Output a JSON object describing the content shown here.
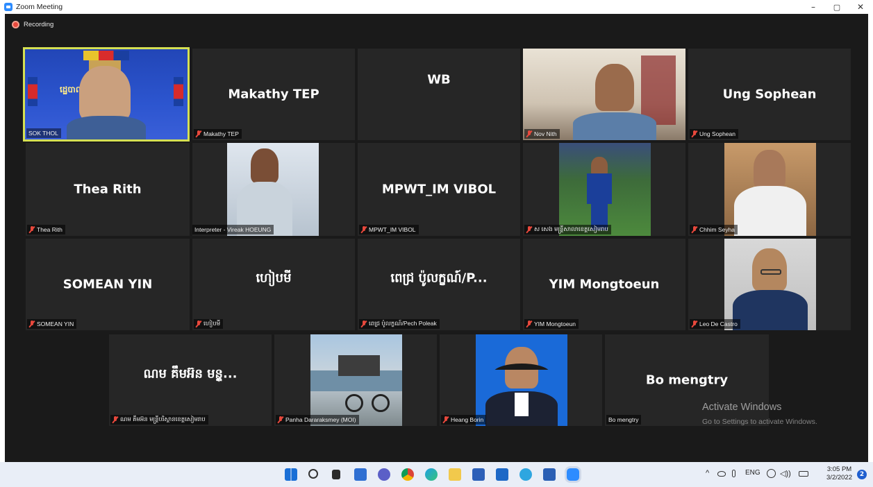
{
  "window": {
    "title": "Zoom Meeting",
    "minimize": "–",
    "maximize": "▢",
    "close": "✕"
  },
  "recording": {
    "label": "Recording"
  },
  "tiles": {
    "sok_thol": {
      "label": "SOK THOL",
      "banner_text": "ដ្ឋេបាលរ"
    },
    "makathy": {
      "name": "Makathy TEP",
      "label": "Makathy TEP"
    },
    "wb": {
      "name": "WB"
    },
    "nov_nith": {
      "label": "Nov Nith"
    },
    "ung_sophean": {
      "name": "Ung Sophean",
      "label": "Ung Sophean"
    },
    "thea_rith": {
      "name": "Thea Rith",
      "label": "Thea Rith"
    },
    "vireak": {
      "label": "Interpreter - Vireak HOEUNG"
    },
    "mpwt": {
      "name": "MPWT_IM VIBOL",
      "label": "MPWT_IM VIBOL"
    },
    "sa_seng": {
      "label": "ស សេង មន្ត្រីសាលាខេត្តសៀមរាប"
    },
    "chhim": {
      "label": "Chhim Seyha"
    },
    "somean": {
      "name": "SOMEAN YIN",
      "label": "SOMEAN YIN"
    },
    "hieb": {
      "name": "ហៀបមី",
      "label": "ហៀបមី"
    },
    "pech": {
      "name": "ពេជ្រ ប៉ូលក្ខណ៍/P...",
      "label": "ពេជ្រ ប៉ូលក្ខណ៍/Pech Poleak"
    },
    "yim": {
      "name": "YIM Mongtoeun",
      "label": "YIM Mongtoeun"
    },
    "leo": {
      "label": "Leo De Castro"
    },
    "nam": {
      "name": "ណម គឹមអ៊ន មន្ត្...",
      "label": "ណម គឹមអ៊ន មន្ត្រីបរិស្ថានខេត្តសៀមរាប"
    },
    "panha": {
      "label": "Panha Dararaksmey (MOI)"
    },
    "heang": {
      "label": "Heang Borin"
    },
    "bo": {
      "name": "Bo mengtry",
      "label": "Bo mengtry"
    }
  },
  "activation": {
    "title": "Activate Windows",
    "subtitle": "Go to Settings to activate Windows."
  },
  "taskbar": {
    "language": "ENG",
    "time": "3:05 PM",
    "date": "3/2/2022",
    "notifications": "2",
    "icons": [
      "windows-start-icon",
      "search-icon",
      "task-view-icon",
      "widgets-icon",
      "chat-icon",
      "chrome-icon",
      "edge-icon",
      "file-explorer-icon",
      "store-icon",
      "mail-icon",
      "telegram-icon",
      "word-icon",
      "zoom-icon"
    ]
  },
  "colors": {
    "active_speaker_border": "#d5e053",
    "tile_bg": "#262626",
    "meeting_bg": "#1a1a1a",
    "muted_red": "#e8483c",
    "taskbar_bg": "#e9eef7"
  }
}
